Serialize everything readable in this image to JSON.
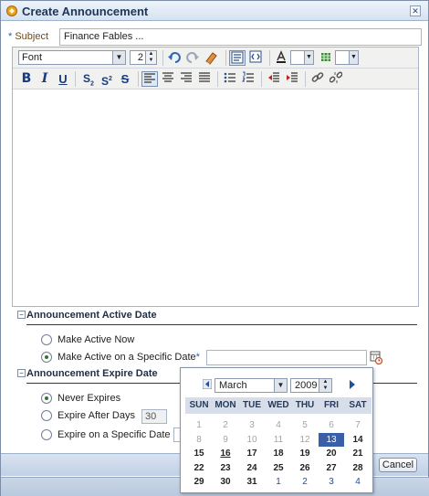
{
  "dialog": {
    "title": "Create Announcement",
    "close_glyph": "✕"
  },
  "subject": {
    "label": "Subject",
    "required_mark": "*",
    "value": "Finance Fables ..."
  },
  "toolbar": {
    "font_label": "Font",
    "font_size": "2",
    "row1_icons": [
      "undo-icon",
      "redo-icon",
      "eraser-icon",
      "rich-text-mode-icon",
      "source-mode-icon",
      "text-color-icon",
      "background-color-icon"
    ],
    "row2_icons": [
      "bold-icon",
      "italic-icon",
      "underline-icon",
      "subscript-icon",
      "superscript-icon",
      "strikethrough-icon",
      "align-left-icon",
      "align-center-icon",
      "align-right-icon",
      "justify-icon",
      "bullet-list-icon",
      "numbered-list-icon",
      "outdent-icon",
      "indent-icon",
      "link-icon",
      "unlink-icon"
    ]
  },
  "active_section": {
    "title": "Announcement Active Date",
    "toggle": "−",
    "options": [
      {
        "label": "Make Active Now",
        "checked": false
      },
      {
        "label": "Make Active on a Specific Date",
        "checked": true
      }
    ],
    "required_mark": "*"
  },
  "expire_section": {
    "title": "Announcement Expire Date",
    "toggle": "−",
    "options": [
      {
        "label": "Never Expires",
        "checked": true
      },
      {
        "label": "Expire After Days",
        "checked": false
      },
      {
        "label": "Expire on a Specific Date",
        "checked": false
      }
    ],
    "days_value": "30"
  },
  "footer": {
    "cancel_label": "Cancel"
  },
  "calendar": {
    "month": "March",
    "year": "2009",
    "weekdays": [
      "SUN",
      "MON",
      "TUE",
      "WED",
      "THU",
      "FRI",
      "SAT"
    ],
    "weeks": [
      [
        "1",
        "2",
        "3",
        "4",
        "5",
        "6",
        "7"
      ],
      [
        "8",
        "9",
        "10",
        "11",
        "12",
        "13",
        "14"
      ],
      [
        "15",
        "16",
        "17",
        "18",
        "19",
        "20",
        "21"
      ],
      [
        "22",
        "23",
        "24",
        "25",
        "26",
        "27",
        "28"
      ],
      [
        "29",
        "30",
        "31",
        "1",
        "2",
        "3",
        "4"
      ]
    ],
    "selected_day": "13",
    "today_day": "16"
  },
  "colors": {
    "accent": "#3a5ea8",
    "title_text": "#1f3557",
    "radio_dot": "#2a7a2a"
  }
}
